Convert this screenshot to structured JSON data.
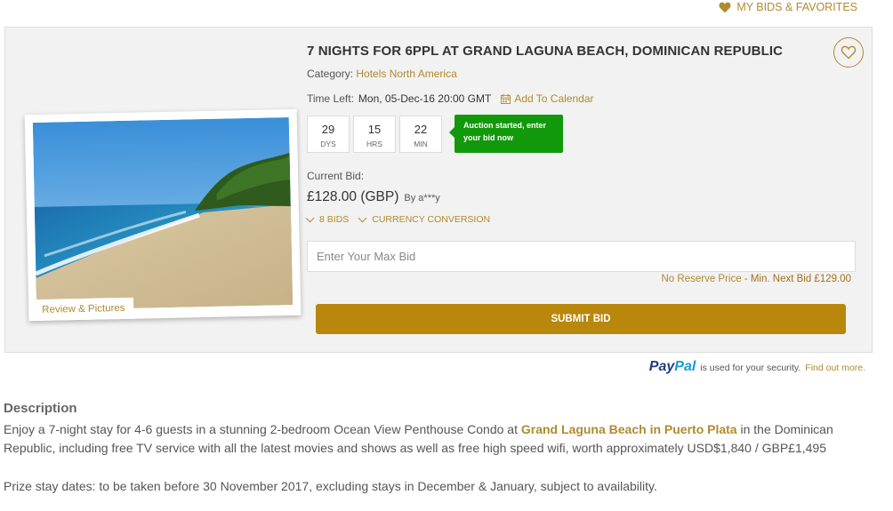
{
  "header": {
    "my_bids_label": "MY BIDS & FAVORITES"
  },
  "auction": {
    "title": "7 NIGHTS FOR 6PPL AT GRAND LAGUNA BEACH, DOMINICAN REPUBLIC",
    "category_label": "Category:",
    "category_value": "Hotels North America",
    "time_left_label": "Time Left:",
    "time_left_value": "Mon, 05-Dec-16 20:00 GMT",
    "add_to_calendar": "Add To Calendar",
    "countdown": [
      {
        "value": "29",
        "unit": "DYS"
      },
      {
        "value": "15",
        "unit": "HRS"
      },
      {
        "value": "22",
        "unit": "MIN"
      }
    ],
    "status_message": "Auction started, enter your bid now",
    "current_bid_label": "Current Bid:",
    "current_bid_amount": "£128.00 (GBP)",
    "current_bid_by": "By a***y",
    "bids_link": "8 BIDS",
    "currency_link": "CURRENCY CONVERSION",
    "max_bid_placeholder": "Enter Your Max Bid",
    "no_reserve": "No Reserve Price",
    "next_bid_text": " - Min. Next Bid £129.00",
    "submit_label": "SUBMIT BID",
    "review_pictures": "Review & Pictures"
  },
  "paypal": {
    "brand_part1": "Pay",
    "brand_part2": "Pal",
    "text": "is used for your security.",
    "link": "Find out more."
  },
  "description": {
    "heading": "Description",
    "text_before": "Enjoy a 7-night stay for 4-6 guests in a stunning 2-bedroom Ocean View Penthouse Condo at ",
    "link": "Grand Laguna Beach in Puerto Plata",
    "text_after": " in the Dominican Republic, including free TV service with all the latest movies and shows as well as free high speed wifi, worth approximately USD$1,840 / GBP£1,495",
    "prize_dates": "Prize stay dates: to be taken before 30 November 2017, excluding stays in December & January, subject to availability."
  },
  "colors": {
    "accent": "#b08a2e",
    "submit": "#b8870b",
    "status_green": "#12990b"
  }
}
